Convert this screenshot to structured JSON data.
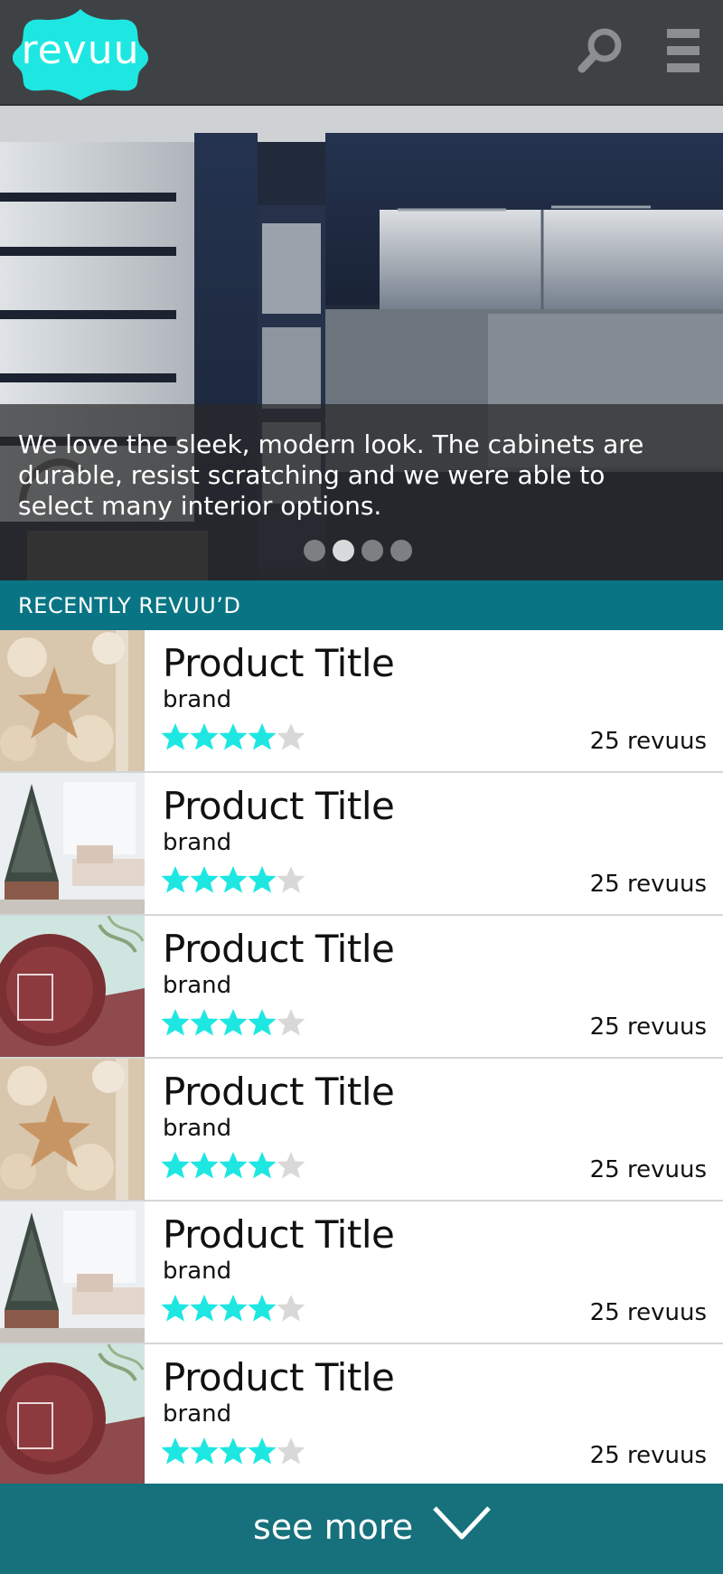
{
  "app": {
    "logo_text": "revuu",
    "brand_color": "#1ee7e2",
    "header_color": "#3f4244"
  },
  "header": {
    "search_icon": "search-icon",
    "menu_icon": "hamburger-menu-icon"
  },
  "hero": {
    "caption": "We love the sleek, modern look. The cabinets are durable, resist scratching and we were able to select many interior options.",
    "slide_count": 4,
    "active_slide": 2
  },
  "section": {
    "title": "RECENTLY REVUU’D"
  },
  "products": [
    {
      "title": "Product Title",
      "brand": "brand",
      "rating": 4,
      "max_rating": 5,
      "count_label": "25 revuus",
      "thumb": "holiday-star-ornament"
    },
    {
      "title": "Product Title",
      "brand": "brand",
      "rating": 4,
      "max_rating": 5,
      "count_label": "25 revuus",
      "thumb": "christmas-tree-living-room"
    },
    {
      "title": "Product Title",
      "brand": "brand",
      "rating": 4,
      "max_rating": 5,
      "count_label": "25 revuus",
      "thumb": "marsala-color-swatch"
    },
    {
      "title": "Product Title",
      "brand": "brand",
      "rating": 4,
      "max_rating": 5,
      "count_label": "25 revuus",
      "thumb": "holiday-star-ornament"
    },
    {
      "title": "Product Title",
      "brand": "brand",
      "rating": 4,
      "max_rating": 5,
      "count_label": "25 revuus",
      "thumb": "christmas-tree-living-room"
    },
    {
      "title": "Product Title",
      "brand": "brand",
      "rating": 4,
      "max_rating": 5,
      "count_label": "25 revuus",
      "thumb": "marsala-color-swatch"
    }
  ],
  "footer": {
    "label": "see more",
    "icon": "chevron-down-icon"
  },
  "colors": {
    "section_bar": "#097584",
    "footer": "#16717c",
    "star_filled": "#1ee7e2",
    "star_empty": "#d8d8d8"
  }
}
